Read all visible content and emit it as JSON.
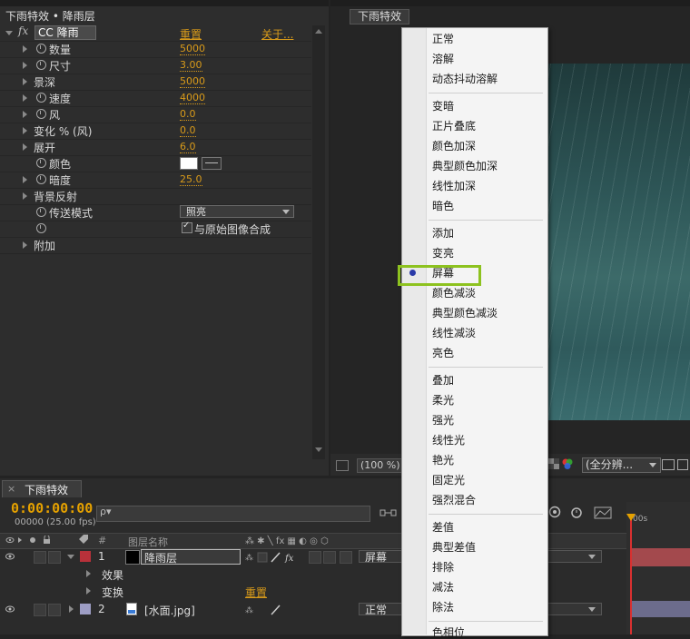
{
  "effect_controls": {
    "path": "下雨特效 • 降雨层",
    "effect_name": "CC 降雨",
    "reset": "重置",
    "about": "关于...",
    "props": [
      {
        "label": "数量",
        "value": "5000"
      },
      {
        "label": "尺寸",
        "value": "3.00"
      },
      {
        "label": "景深",
        "value": "5000"
      },
      {
        "label": "速度",
        "value": "4000"
      },
      {
        "label": "风",
        "value": "0.0"
      },
      {
        "label": "变化 % (风)",
        "value": "0.0"
      },
      {
        "label": "展开",
        "value": "6.0"
      },
      {
        "label": "颜色",
        "value": ""
      },
      {
        "label": "暗度",
        "value": "25.0"
      },
      {
        "label": "背景反射",
        "value": ""
      },
      {
        "label": "传送模式",
        "value": "照亮"
      },
      {
        "label": "",
        "value": "与原始图像合成"
      },
      {
        "label": "附加",
        "value": ""
      }
    ]
  },
  "viewer": {
    "tab": "下雨特效",
    "zoom": "(100 %)",
    "resolution": "(全分辨..."
  },
  "timeline": {
    "tab": "下雨特效",
    "timecode": "0:00:00:00",
    "fps": "00000 (25.00 fps)",
    "search_placeholder": "ρ▾",
    "header_label_col": "图层名称",
    "header_num": "#",
    "ruler": "00s",
    "layers": [
      {
        "num": "1",
        "name": "降雨层",
        "mode": "屏幕",
        "color": "#b8313a"
      },
      {
        "sub": "效果"
      },
      {
        "sub": "变换",
        "reset": "重置"
      },
      {
        "num": "2",
        "name": "[水面.jpg]",
        "mode": "正常",
        "color": "#9d9dc4"
      }
    ]
  },
  "blend_menu": {
    "groups": [
      [
        "正常",
        "溶解",
        "动态抖动溶解"
      ],
      [
        "变暗",
        "正片叠底",
        "颜色加深",
        "典型颜色加深",
        "线性加深",
        "暗色"
      ],
      [
        "添加",
        "变亮",
        "屏幕",
        "颜色减淡",
        "典型颜色减淡",
        "线性减淡",
        "亮色"
      ],
      [
        "叠加",
        "柔光",
        "强光",
        "线性光",
        "艳光",
        "固定光",
        "强烈混合"
      ],
      [
        "差值",
        "典型差值",
        "排除",
        "减法",
        "除法"
      ],
      [
        "色相位"
      ]
    ],
    "selected": "屏幕",
    "highlight_color": "#8dc21f"
  }
}
